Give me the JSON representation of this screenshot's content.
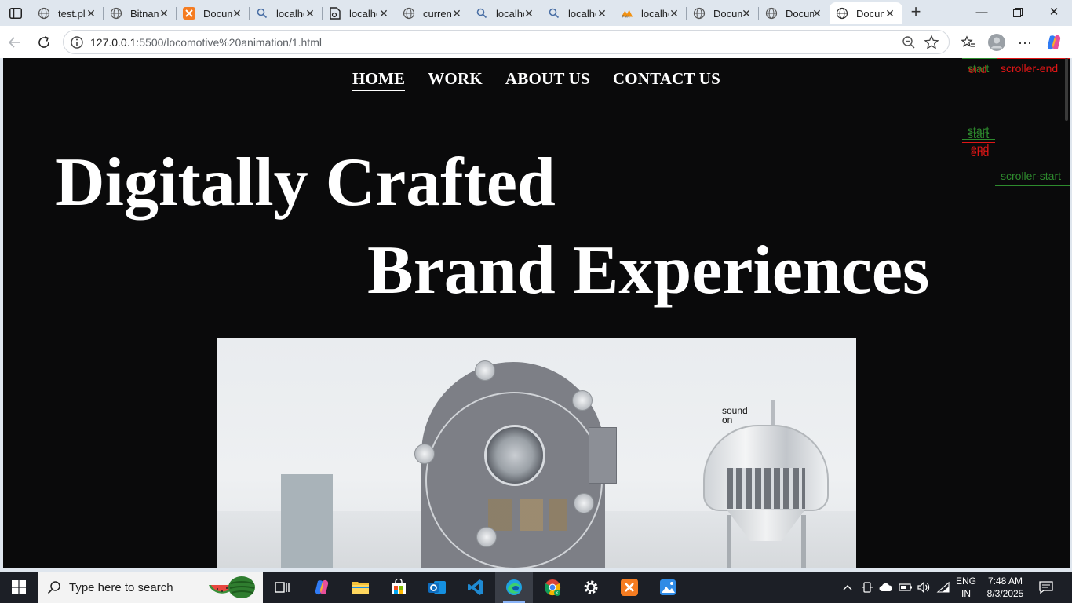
{
  "browser": {
    "tabs": [
      {
        "label": "test.pl",
        "icon": "globe-icon"
      },
      {
        "label": "Bitnami",
        "icon": "globe-icon"
      },
      {
        "label": "Document",
        "icon": "xampp-icon"
      },
      {
        "label": "localhost",
        "icon": "search-icon"
      },
      {
        "label": "localhost",
        "icon": "document-icon"
      },
      {
        "label": "current",
        "icon": "globe-icon"
      },
      {
        "label": "localhost",
        "icon": "search-icon"
      },
      {
        "label": "localhost",
        "icon": "search-icon"
      },
      {
        "label": "localhost",
        "icon": "phpmyadmin-icon"
      },
      {
        "label": "Document",
        "icon": "globe-icon"
      },
      {
        "label": "Document",
        "icon": "globe-icon"
      },
      {
        "label": "Document",
        "icon": "globe-icon",
        "active": true
      }
    ],
    "address": {
      "host": "127.0.0.1",
      "path": ":5500/locomotive%20animation/1.html"
    }
  },
  "page": {
    "nav": [
      "HOME",
      "WORK",
      "ABOUT US",
      "CONTACT US"
    ],
    "hero_line1": "Digitally Crafted",
    "hero_line2": "Brand Experiences",
    "markers": {
      "start1": "start",
      "end1": "end",
      "scroller_end": "scroller-end",
      "start2": "start",
      "start3": "start",
      "end2": "end",
      "end3": "end",
      "scroller_start": "scroller-start"
    },
    "video": {
      "sound_line1": "sound",
      "sound_line2": "on"
    }
  },
  "taskbar": {
    "search_placeholder": "Type here to search",
    "lang_line1": "ENG",
    "lang_line2": "IN",
    "time": "7:48 AM",
    "date": "8/3/2025"
  },
  "colors": {
    "page_bg": "#0a0a0b",
    "marker_green": "#2e8b2e",
    "marker_red": "#e01616"
  }
}
